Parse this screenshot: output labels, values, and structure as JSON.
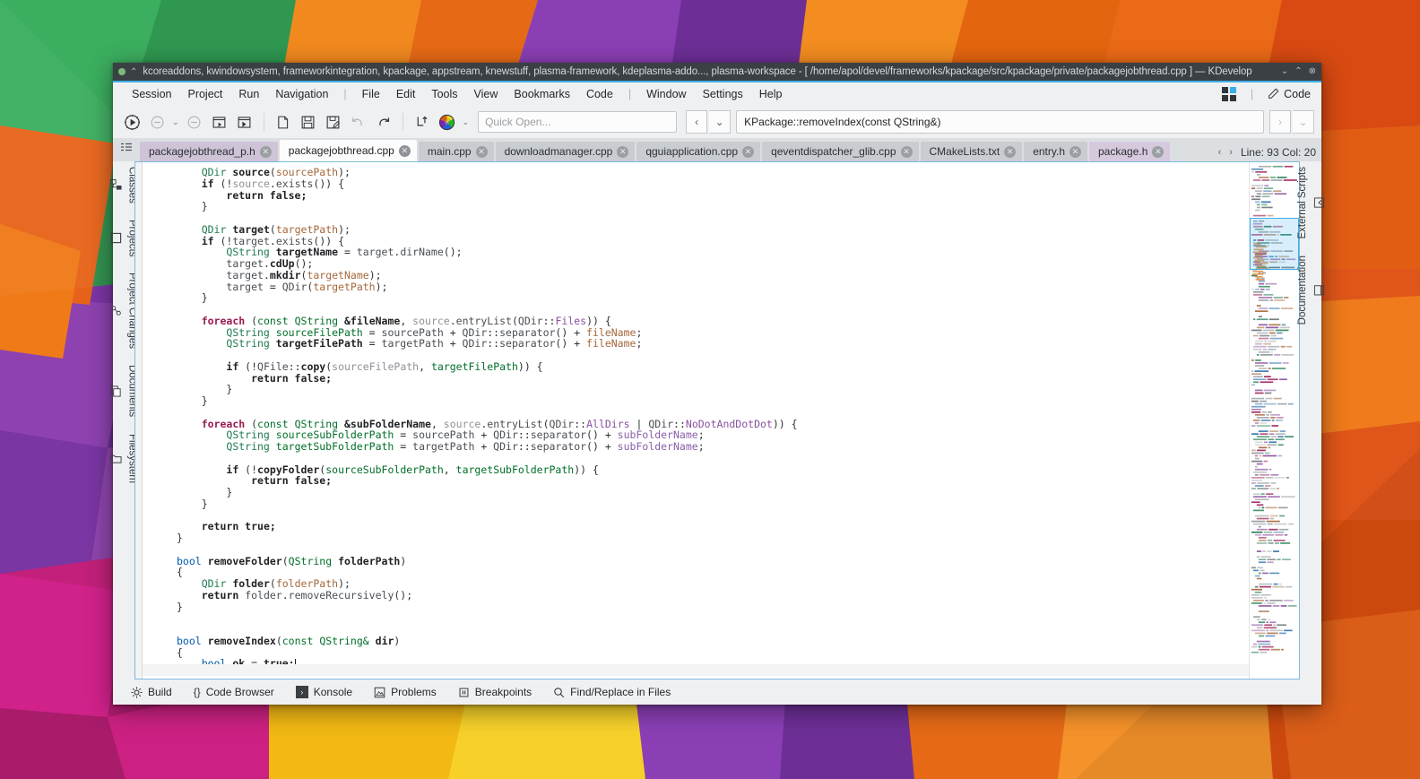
{
  "window": {
    "title": "kcoreaddons, kwindowsystem, frameworkintegration, kpackage, appstream, knewstuff, plasma-framework, kdeplasma-addo..., plasma-workspace - [ /home/apol/devel/frameworks/kpackage/src/kpackage/private/packagejobthread.cpp ] — KDevelop",
    "pin_icon": "pin-icon",
    "status_dot": "modified-indicator",
    "buttons": {
      "minimize": "⌄",
      "maximize": "⌃",
      "close": "⊗"
    },
    "accent": "#3daee9",
    "titlebar_bg": "#3b4045"
  },
  "menubar": {
    "items": [
      "Session",
      "Project",
      "Run",
      "Navigation",
      "|",
      "File",
      "Edit",
      "Tools",
      "View",
      "Bookmarks",
      "Code",
      "|",
      "Window",
      "Settings",
      "Help"
    ],
    "right": {
      "grid_icon": "window-layout-icon",
      "separator": "|",
      "mode_icon": "pencil-icon",
      "mode_label": "Code"
    }
  },
  "toolbar": {
    "icons": [
      {
        "name": "execute-icon",
        "glyph": "▶",
        "dim": false
      },
      {
        "name": "stop-icon",
        "glyph": "⊖",
        "dim": true
      },
      {
        "name": "stop-dropdown-caret-icon",
        "glyph": "⌄",
        "dim": true
      },
      {
        "name": "stop-all-icon",
        "glyph": "⊖",
        "dim": true
      },
      {
        "name": "run-current-icon",
        "glyph": "▣",
        "dim": false
      },
      {
        "name": "debug-icon",
        "glyph": "▶",
        "dim": false
      },
      {
        "name": "new-file-icon",
        "glyph": "🗋",
        "dim": false
      },
      {
        "name": "save-icon",
        "glyph": "💾",
        "dim": false
      },
      {
        "name": "save-as-icon",
        "glyph": "💾",
        "dim": false
      },
      {
        "name": "undo-icon",
        "glyph": "↶",
        "dim": true
      },
      {
        "name": "redo-icon",
        "glyph": "↷",
        "dim": false
      },
      {
        "name": "jump-to-declaration-icon",
        "glyph": "⇡",
        "dim": false
      },
      {
        "name": "color-wheel-icon",
        "glyph": "◉",
        "dim": false
      },
      {
        "name": "color-dropdown-caret-icon",
        "glyph": "⌄",
        "dim": true
      }
    ],
    "quick_open_placeholder": "Quick Open...",
    "nav_back_icon": "chevron-left-icon",
    "nav_back_caret_icon": "chevron-down-icon",
    "context_browser_value": "KPackage::removeIndex(const QString&)",
    "nav_forward_icon": "chevron-right-icon",
    "nav_forward_caret_icon": "chevron-down-icon"
  },
  "tabs": {
    "list_icon": "tab-list-icon",
    "items": [
      {
        "label": "packagejobthread_p.h",
        "active": false,
        "kind": "header"
      },
      {
        "label": "packagejobthread.cpp",
        "active": true,
        "kind": "source"
      },
      {
        "label": "main.cpp",
        "active": false,
        "kind": "source"
      },
      {
        "label": "downloadmanager.cpp",
        "active": false,
        "kind": "source"
      },
      {
        "label": "qguiapplication.cpp",
        "active": false,
        "kind": "source"
      },
      {
        "label": "qeventdispatcher_glib.cpp",
        "active": false,
        "kind": "source"
      },
      {
        "label": "CMakeLists.txt",
        "active": false,
        "kind": "source"
      },
      {
        "label": "entry.h",
        "active": false,
        "kind": "source"
      },
      {
        "label": "package.h",
        "active": false,
        "kind": "header"
      }
    ],
    "close_glyph": "✕",
    "prev_icon": "chevron-left-icon",
    "next_icon": "chevron-right-icon",
    "cursor_position": "Line: 93 Col: 20",
    "terminal_icon": "terminal-icon"
  },
  "left_sidebar": {
    "items": [
      {
        "label": "Classes",
        "icon": "classes-icon",
        "glyph": "▤"
      },
      {
        "label": "Projects",
        "icon": "projects-icon",
        "glyph": "▭"
      },
      {
        "label": "Project Changes",
        "icon": "project-changes-icon",
        "glyph": "⎋"
      },
      {
        "label": "Documents",
        "icon": "documents-icon",
        "glyph": "❐"
      },
      {
        "label": "Filesystem",
        "icon": "filesystem-icon",
        "glyph": "🗀"
      }
    ]
  },
  "right_sidebar": {
    "items": [
      {
        "label": "External Scripts",
        "icon": "external-scripts-icon",
        "glyph": "▷"
      },
      {
        "label": "Documentation",
        "icon": "documentation-icon",
        "glyph": "▤"
      }
    ]
  },
  "editor": {
    "file": "packagejobthread.cpp",
    "minimap_viewport_label": "minimap-viewport",
    "code_lines": [
      [
        [
          "    ",
          ""
        ],
        [
          "QDir",
          "typ"
        ],
        [
          " ",
          ""
        ],
        [
          "source",
          "var"
        ],
        [
          "(",
          "op"
        ],
        [
          "sourcePath",
          "arg"
        ],
        [
          ");",
          "op"
        ]
      ],
      [
        [
          "    ",
          ""
        ],
        [
          "if",
          "k"
        ],
        [
          " (",
          "op"
        ],
        [
          "!",
          "op"
        ],
        [
          "source",
          "gray"
        ],
        [
          ".",
          "op"
        ],
        [
          "exists",
          "mem"
        ],
        [
          "()) {",
          "op"
        ]
      ],
      [
        [
          "        ",
          ""
        ],
        [
          "return false;",
          "k"
        ]
      ],
      [
        [
          "    ",
          ""
        ],
        [
          "}",
          "op"
        ]
      ],
      [],
      [
        [
          "    ",
          ""
        ],
        [
          "QDir",
          "typ"
        ],
        [
          " ",
          ""
        ],
        [
          "target",
          "var"
        ],
        [
          "(",
          "op"
        ],
        [
          "targetPath",
          "arg"
        ],
        [
          ");",
          "op"
        ]
      ],
      [
        [
          "    ",
          ""
        ],
        [
          "if",
          "k"
        ],
        [
          " (",
          "op"
        ],
        [
          "!",
          "op"
        ],
        [
          "target",
          "mem"
        ],
        [
          ".",
          "op"
        ],
        [
          "exists",
          "mem"
        ],
        [
          "()) {",
          "op"
        ]
      ],
      [
        [
          "        ",
          ""
        ],
        [
          "QString",
          "typ"
        ],
        [
          " ",
          ""
        ],
        [
          "targetName",
          "var"
        ],
        [
          " = ",
          "op"
        ],
        [
          "target",
          "mem"
        ],
        [
          ".",
          "op"
        ],
        [
          "dirName",
          "mem"
        ],
        [
          "();",
          "op"
        ]
      ],
      [
        [
          "        ",
          ""
        ],
        [
          "target",
          "mem"
        ],
        [
          ".",
          "op"
        ],
        [
          "cdUp",
          "var"
        ],
        [
          "();",
          "op"
        ]
      ],
      [
        [
          "        ",
          ""
        ],
        [
          "target",
          "mem"
        ],
        [
          ".",
          "op"
        ],
        [
          "mkdir",
          "var"
        ],
        [
          "(",
          "op"
        ],
        [
          "targetName",
          "arg"
        ],
        [
          ");",
          "op"
        ]
      ],
      [
        [
          "        ",
          ""
        ],
        [
          "target",
          "mem"
        ],
        [
          " = ",
          "op"
        ],
        [
          "QDir",
          "mem"
        ],
        [
          "(",
          "op"
        ],
        [
          "targetPath",
          "arg"
        ],
        [
          ");",
          "op"
        ]
      ],
      [
        [
          "    ",
          ""
        ],
        [
          "}",
          "op"
        ]
      ],
      [],
      [
        [
          "    ",
          ""
        ],
        [
          "foreach",
          "kw"
        ],
        [
          " (",
          "op"
        ],
        [
          "const",
          "typd"
        ],
        [
          " ",
          ""
        ],
        [
          "QString",
          "typd"
        ],
        [
          " ",
          ""
        ],
        [
          "&fileName",
          "var"
        ],
        [
          ", ",
          "op"
        ],
        [
          "source",
          "gray"
        ],
        [
          ".",
          "op"
        ],
        [
          "entryList",
          "mem"
        ],
        [
          "(",
          "op"
        ],
        [
          "QDir",
          "mem"
        ],
        [
          "::",
          "op"
        ],
        [
          "Files",
          "en"
        ],
        [
          ")) {",
          "op"
        ]
      ],
      [
        [
          "        ",
          ""
        ],
        [
          "QString",
          "typ"
        ],
        [
          " ",
          ""
        ],
        [
          "sourceFilePath",
          "typd"
        ],
        [
          " = ",
          "op"
        ],
        [
          "sourcePath",
          "mem"
        ],
        [
          " + ",
          "op"
        ],
        [
          "QDir",
          "mem"
        ],
        [
          "::",
          "op"
        ],
        [
          "separator",
          "mem"
        ],
        [
          "() + ",
          "op"
        ],
        [
          "fileName",
          "arg"
        ],
        [
          ";",
          "op"
        ]
      ],
      [
        [
          "        ",
          ""
        ],
        [
          "QString",
          "typ"
        ],
        [
          " ",
          ""
        ],
        [
          "targetFilePath",
          "var"
        ],
        [
          " = ",
          "op"
        ],
        [
          "targetPath",
          "mem"
        ],
        [
          " + ",
          "op"
        ],
        [
          "QDir",
          "mem"
        ],
        [
          "::",
          "op"
        ],
        [
          "separator",
          "mem"
        ],
        [
          "() + ",
          "op"
        ],
        [
          "fileName",
          "arg"
        ],
        [
          ";",
          "op"
        ]
      ],
      [],
      [
        [
          "        ",
          ""
        ],
        [
          "if",
          "k"
        ],
        [
          " (",
          "op"
        ],
        [
          "!",
          "op"
        ],
        [
          "QFile",
          "mem"
        ],
        [
          "::",
          "op"
        ],
        [
          "copy",
          "var"
        ],
        [
          "(",
          "op"
        ],
        [
          "sourceFilePath",
          "gray"
        ],
        [
          ", ",
          "op"
        ],
        [
          "targetFilePath",
          "typd"
        ],
        [
          ")) {",
          "op"
        ]
      ],
      [
        [
          "            ",
          ""
        ],
        [
          "return false;",
          "k"
        ]
      ],
      [
        [
          "        ",
          ""
        ],
        [
          "}",
          "op"
        ]
      ],
      [
        [
          "    ",
          ""
        ],
        [
          "}",
          "op"
        ]
      ],
      [],
      [
        [
          "    ",
          ""
        ],
        [
          "foreach",
          "kw"
        ],
        [
          " (",
          "op"
        ],
        [
          "const",
          "typd"
        ],
        [
          " ",
          ""
        ],
        [
          "QString",
          "typd"
        ],
        [
          " ",
          ""
        ],
        [
          "&subFolderName",
          "var"
        ],
        [
          ", ",
          "op"
        ],
        [
          "source",
          "gray"
        ],
        [
          ".",
          "op"
        ],
        [
          "entryList",
          "mem"
        ],
        [
          "(",
          "op"
        ],
        [
          "QDir",
          "mem"
        ],
        [
          "::",
          "op"
        ],
        [
          "AllDirs",
          "en"
        ],
        [
          " | ",
          "op"
        ],
        [
          "QDir",
          "mem"
        ],
        [
          "::",
          "op"
        ],
        [
          "NoDotAndDotDot",
          "en"
        ],
        [
          ")) {",
          "op"
        ]
      ],
      [
        [
          "        ",
          ""
        ],
        [
          "QString",
          "typ"
        ],
        [
          " ",
          ""
        ],
        [
          "sourceSubFolderPath",
          "typd"
        ],
        [
          " = ",
          "op"
        ],
        [
          "sourcePath",
          "mem"
        ],
        [
          " + ",
          "op"
        ],
        [
          "QDir",
          "mem"
        ],
        [
          "::",
          "op"
        ],
        [
          "separator",
          "mem"
        ],
        [
          "() + ",
          "op"
        ],
        [
          "subFolderName",
          "local"
        ],
        [
          ";",
          "op"
        ]
      ],
      [
        [
          "        ",
          ""
        ],
        [
          "QString",
          "typ"
        ],
        [
          " ",
          ""
        ],
        [
          "targetSubFolderPath",
          "typd"
        ],
        [
          " = ",
          "op"
        ],
        [
          "targetPath",
          "mem"
        ],
        [
          " + ",
          "op"
        ],
        [
          "QDir",
          "mem"
        ],
        [
          "::",
          "op"
        ],
        [
          "separator",
          "mem"
        ],
        [
          "() + ",
          "op"
        ],
        [
          "subFolderName",
          "local"
        ],
        [
          ";",
          "op"
        ]
      ],
      [],
      [
        [
          "        ",
          ""
        ],
        [
          "if",
          "k"
        ],
        [
          " (",
          "op"
        ],
        [
          "!",
          "op"
        ],
        [
          "copyFolder",
          "var"
        ],
        [
          "(",
          "op"
        ],
        [
          "sourceSubFolderPath",
          "typd"
        ],
        [
          ", ",
          "op"
        ],
        [
          "targetSubFolderPath",
          "typd"
        ],
        [
          ")) {",
          "op"
        ]
      ],
      [
        [
          "            ",
          ""
        ],
        [
          "return false;",
          "k"
        ]
      ],
      [
        [
          "        ",
          ""
        ],
        [
          "}",
          "op"
        ]
      ],
      [
        [
          "    ",
          ""
        ],
        [
          "}",
          "op"
        ]
      ],
      [],
      [
        [
          "    ",
          ""
        ],
        [
          "return true;",
          "k"
        ]
      ],
      [
        [
          "}",
          "op"
        ]
      ],
      [],
      [
        [
          "bool",
          "bt"
        ],
        [
          " ",
          ""
        ],
        [
          "removeFolder",
          "fn"
        ],
        [
          "(",
          "op"
        ],
        [
          "QString",
          "typd"
        ],
        [
          " ",
          ""
        ],
        [
          "folderPath",
          "var"
        ],
        [
          ")",
          "op"
        ]
      ],
      [
        [
          "{",
          "op"
        ]
      ],
      [
        [
          "    ",
          ""
        ],
        [
          "QDir",
          "typ"
        ],
        [
          " ",
          ""
        ],
        [
          "folder",
          "var"
        ],
        [
          "(",
          "op"
        ],
        [
          "folderPath",
          "arg"
        ],
        [
          ");",
          "op"
        ]
      ],
      [
        [
          "    ",
          ""
        ],
        [
          "return",
          "k"
        ],
        [
          " ",
          ""
        ],
        [
          "folder",
          "mem"
        ],
        [
          ".",
          "op"
        ],
        [
          "removeRecursively",
          "mem"
        ],
        [
          "();",
          "op"
        ]
      ],
      [
        [
          "}",
          "op"
        ]
      ],
      [],
      [],
      [
        [
          "bool",
          "bt"
        ],
        [
          " ",
          ""
        ],
        [
          "removeIndex",
          "fn"
        ],
        [
          "(",
          "op"
        ],
        [
          "const",
          "typd"
        ],
        [
          " ",
          ""
        ],
        [
          "QString&",
          "typd"
        ],
        [
          " ",
          ""
        ],
        [
          "dir",
          "var"
        ],
        [
          ")",
          "op"
        ]
      ],
      [
        [
          "{",
          "op"
        ]
      ],
      [
        [
          "    ",
          ""
        ],
        [
          "bool",
          "bt"
        ],
        [
          " ",
          ""
        ],
        [
          "ok",
          "var"
        ],
        [
          " = ",
          "op"
        ],
        [
          "true;",
          "k"
        ]
      ]
    ]
  },
  "statusbar": {
    "items": [
      {
        "label": "Build",
        "icon": "build-gear-icon",
        "glyph": "⚙"
      },
      {
        "label": "Code Browser",
        "icon": "code-browser-icon",
        "glyph": "{}"
      },
      {
        "label": "Konsole",
        "icon": "konsole-icon",
        "glyph": "▶"
      },
      {
        "label": "Problems",
        "icon": "problems-icon",
        "glyph": "⚠"
      },
      {
        "label": "Breakpoints",
        "icon": "breakpoints-icon",
        "glyph": "❙❙"
      },
      {
        "label": "Find/Replace in Files",
        "icon": "search-icon",
        "glyph": "⌕"
      }
    ]
  },
  "wallpaper": {
    "name": "low-poly-geometric-wallpaper",
    "colors": [
      "#3aa95a",
      "#2e9b4f",
      "#f07a18",
      "#e8631a",
      "#8b3fb5",
      "#6d2f96",
      "#f5c518",
      "#c2207a",
      "#e0187f",
      "#5b2d82",
      "#d94e0f",
      "#f29a1b"
    ]
  }
}
